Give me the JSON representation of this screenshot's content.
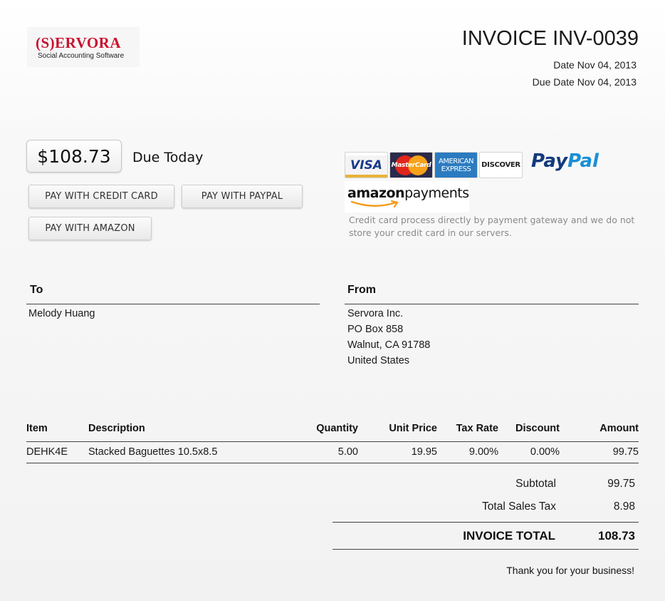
{
  "company": {
    "logo_text": "(S)ERVORA",
    "tagline": "Social Accounting Software"
  },
  "invoice": {
    "title": "INVOICE INV-0039",
    "date": "Date Nov 04, 2013",
    "due_date": "Due Date Nov 04, 2013"
  },
  "payment": {
    "amount": "$108.73",
    "due_label": "Due Today",
    "buttons": {
      "credit_card": "PAY WITH CREDIT CARD",
      "paypal": "PAY WITH PAYPAL",
      "amazon": "PAY WITH AMAZON"
    },
    "logos": {
      "visa": "VISA",
      "mastercard": "MasterCard",
      "amex_line1": "AMERICAN",
      "amex_line2": "EXPRESS",
      "discover": "DISCOVER",
      "paypal_pay": "Pay",
      "paypal_pal": "Pal",
      "amazon_bold": "amazon",
      "amazon_rest": "payments"
    },
    "gateway_note": "Credit card process directly by payment gateway and we do not store your credit card in our servers."
  },
  "to": {
    "heading": "To",
    "lines": [
      "Melody Huang"
    ]
  },
  "from": {
    "heading": "From",
    "lines": [
      "Servora Inc.",
      "PO Box 858",
      "Walnut, CA 91788",
      "United States"
    ]
  },
  "items": {
    "headers": {
      "item": "Item",
      "description": "Description",
      "quantity": "Quantity",
      "unit_price": "Unit Price",
      "tax_rate": "Tax Rate",
      "discount": "Discount",
      "amount": "Amount"
    },
    "rows": [
      {
        "item": "DEHK4E",
        "description": "Stacked Baguettes 10.5x8.5",
        "quantity": "5.00",
        "unit_price": "19.95",
        "tax_rate": "9.00%",
        "discount": "0.00%",
        "amount": "99.75"
      }
    ]
  },
  "totals": {
    "subtotal_label": "Subtotal",
    "subtotal": "99.75",
    "tax_label": "Total Sales Tax",
    "tax": "8.98",
    "total_label": "INVOICE TOTAL",
    "total": "108.73"
  },
  "footer": {
    "thanks": "Thank you for your business!"
  },
  "colors": {
    "brand_red": "#c8102e",
    "amex_blue": "#2b7bc0",
    "paypal_dark": "#123a7c",
    "paypal_light": "#1a8fd6",
    "note_gray": "#8a8a8a"
  }
}
